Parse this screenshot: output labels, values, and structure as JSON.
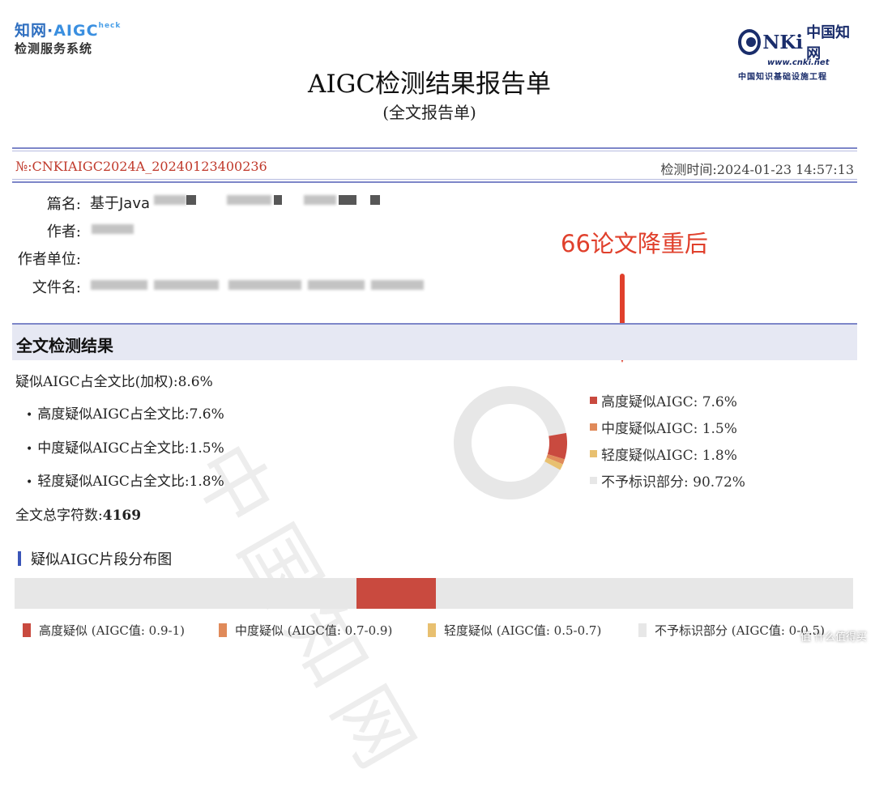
{
  "header": {
    "logo_left_line1_a": "知网·",
    "logo_left_line1_b": "AIGC",
    "logo_left_line1_c": "heck",
    "logo_left_line2": "检测服务系统",
    "logo_right_word": "NKi",
    "logo_right_cn": "中国知网",
    "logo_right_url": "www.cnki.net",
    "logo_right_sub": "中国知识基础设施工程",
    "title": "AIGC检测结果报告单",
    "subtitle": "(全文报告单)"
  },
  "report": {
    "number": "№:CNKIAIGC2024A_20240123400236",
    "time": "检测时间:2024-01-23 14:57:13"
  },
  "info": {
    "title_label": "篇名:",
    "title_value": "基于Java",
    "author_label": "作者:",
    "unit_label": "作者单位:",
    "file_label": "文件名:"
  },
  "annotation": "66论文降重后",
  "section_title": "全文检测结果",
  "results": {
    "weighted": "疑似AIGC占全文比(加权):8.6%",
    "high": "高度疑似AIGC占全文比:7.6%",
    "mid": "中度疑似AIGC占全文比:1.5%",
    "low": "轻度疑似AIGC占全文比:1.8%",
    "total_label": "全文总字符数:",
    "total_value": "4169"
  },
  "legend": [
    {
      "label": "高度疑似AIGC: 7.6%",
      "color": "#c94a3f"
    },
    {
      "label": "中度疑似AIGC: 1.5%",
      "color": "#e08a5a"
    },
    {
      "label": "轻度疑似AIGC: 1.8%",
      "color": "#e8c070"
    },
    {
      "label": "不予标识部分: 90.72%",
      "color": "#e7e7e7"
    }
  ],
  "chart_data": {
    "type": "pie",
    "categories": [
      "高度疑似AIGC",
      "中度疑似AIGC",
      "轻度疑似AIGC",
      "不予标识部分"
    ],
    "values": [
      7.6,
      1.5,
      1.8,
      90.72
    ],
    "colors": [
      "#c94a3f",
      "#e08a5a",
      "#e8c070",
      "#e7e7e7"
    ],
    "title": "",
    "legend_position": "right"
  },
  "distribution": {
    "title": "疑似AIGC片段分布图",
    "segments": [
      {
        "start": 0.408,
        "end": 0.502,
        "color": "#c94a3f"
      }
    ],
    "keys": [
      {
        "label": "高度疑似 (AIGC值: 0.9-1)",
        "color": "#c94a3f"
      },
      {
        "label": "中度疑似 (AIGC值: 0.7-0.9)",
        "color": "#e08a5a"
      },
      {
        "label": "轻度疑似 (AIGC值: 0.5-0.7)",
        "color": "#e8c070"
      },
      {
        "label": "不予标识部分 (AIGC值: 0-0.5)",
        "color": "#e7e7e7"
      }
    ]
  },
  "watermark": "中国知网",
  "site_mark": "值 什么值得买"
}
